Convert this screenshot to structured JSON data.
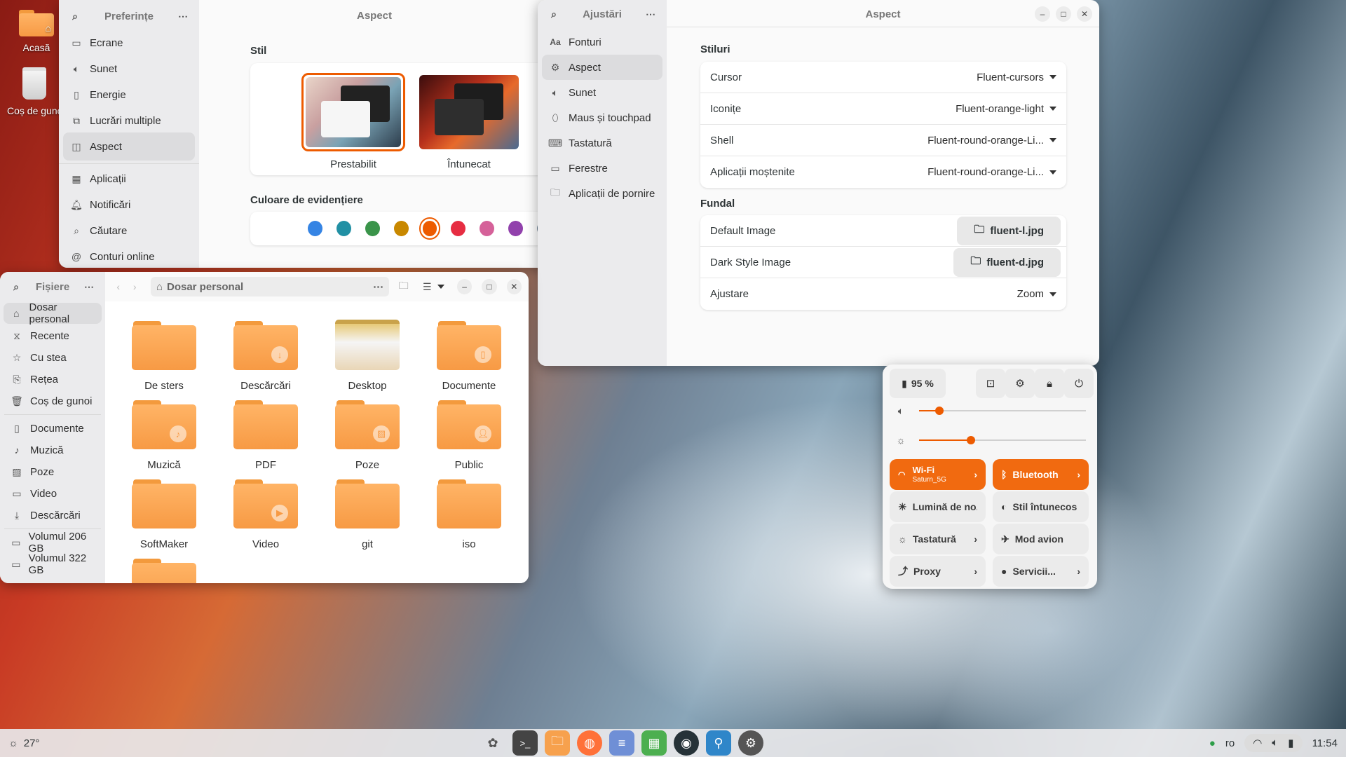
{
  "desktop": {
    "icons": [
      {
        "label": "Acasă"
      },
      {
        "label": "Coș de gunoi"
      }
    ]
  },
  "preferences": {
    "sidebar_title": "Preferințe",
    "page_title": "Aspect",
    "items": [
      {
        "label": "Ecrane",
        "icon": "monitor-icon"
      },
      {
        "label": "Sunet",
        "icon": "speaker-icon"
      },
      {
        "label": "Energie",
        "icon": "battery-icon"
      },
      {
        "label": "Lucrări multiple",
        "icon": "multitask-icon"
      },
      {
        "label": "Aspect",
        "icon": "appearance-icon"
      },
      {
        "label": "Aplicații",
        "icon": "apps-icon"
      },
      {
        "label": "Notificări",
        "icon": "bell-icon"
      },
      {
        "label": "Căutare",
        "icon": "search-icon"
      },
      {
        "label": "Conturi online",
        "icon": "at-icon"
      }
    ],
    "style_heading": "Stil",
    "styles": [
      {
        "label": "Prestabilit",
        "selected": true
      },
      {
        "label": "Întunecat",
        "selected": false
      }
    ],
    "accent_heading": "Culoare de evidențiere",
    "accent_colors": [
      "#3584e4",
      "#2190a4",
      "#3a944a",
      "#c88800",
      "#ed5b00",
      "#e62d42",
      "#d56199",
      "#9141ac",
      "#6f8396"
    ],
    "accent_selected": 4
  },
  "tweaks": {
    "sidebar_title": "Ajustări",
    "page_title": "Aspect",
    "items": [
      {
        "label": "Fonturi"
      },
      {
        "label": "Aspect"
      },
      {
        "label": "Sunet"
      },
      {
        "label": "Maus și touchpad"
      },
      {
        "label": "Tastatură"
      },
      {
        "label": "Ferestre"
      },
      {
        "label": "Aplicații de pornire"
      }
    ],
    "styles_heading": "Stiluri",
    "styles_rows": [
      {
        "label": "Cursor",
        "value": "Fluent-cursors"
      },
      {
        "label": "Iconițe",
        "value": "Fluent-orange-light"
      },
      {
        "label": "Shell",
        "value": "Fluent-round-orange-Li..."
      },
      {
        "label": "Aplicații moștenite",
        "value": "Fluent-round-orange-Li..."
      }
    ],
    "bg_heading": "Fundal",
    "bg_rows": [
      {
        "label": "Default Image",
        "value": "fluent-l.jpg"
      },
      {
        "label": "Dark Style Image",
        "value": "fluent-d.jpg"
      },
      {
        "label": "Ajustare",
        "value": "Zoom"
      }
    ]
  },
  "files": {
    "sidebar_title": "Fișiere",
    "location": "Dosar personal",
    "places": [
      {
        "label": "Dosar personal"
      },
      {
        "label": "Recente"
      },
      {
        "label": "Cu stea"
      },
      {
        "label": "Rețea"
      },
      {
        "label": "Coș de gunoi"
      }
    ],
    "bookmarks": [
      {
        "label": "Documente"
      },
      {
        "label": "Muzică"
      },
      {
        "label": "Poze"
      },
      {
        "label": "Video"
      },
      {
        "label": "Descărcări"
      }
    ],
    "volumes": [
      {
        "label": "Volumul 206 GB"
      },
      {
        "label": "Volumul 322 GB"
      }
    ],
    "items": [
      {
        "label": "De sters"
      },
      {
        "label": "Descărcări"
      },
      {
        "label": "Desktop"
      },
      {
        "label": "Documente"
      },
      {
        "label": "Muzică"
      },
      {
        "label": "PDF"
      },
      {
        "label": "Poze"
      },
      {
        "label": "Public"
      },
      {
        "label": "SoftMaker"
      },
      {
        "label": "Video"
      },
      {
        "label": "git"
      },
      {
        "label": "iso"
      }
    ]
  },
  "quick_settings": {
    "battery": "95 %",
    "volume_level": 0.12,
    "brightness_level": 0.31,
    "wifi_label": "Wi-Fi",
    "wifi_network": "Saturn_5G",
    "bluetooth_label": "Bluetooth",
    "night_light": "Lumină de no...",
    "dark_style": "Stil întunecos",
    "keyboard": "Tastatură",
    "airplane": "Mod avion",
    "proxy": "Proxy",
    "services": "Servicii..."
  },
  "taskbar": {
    "weather": "27°",
    "lang": "ro",
    "clock": "11:54"
  }
}
